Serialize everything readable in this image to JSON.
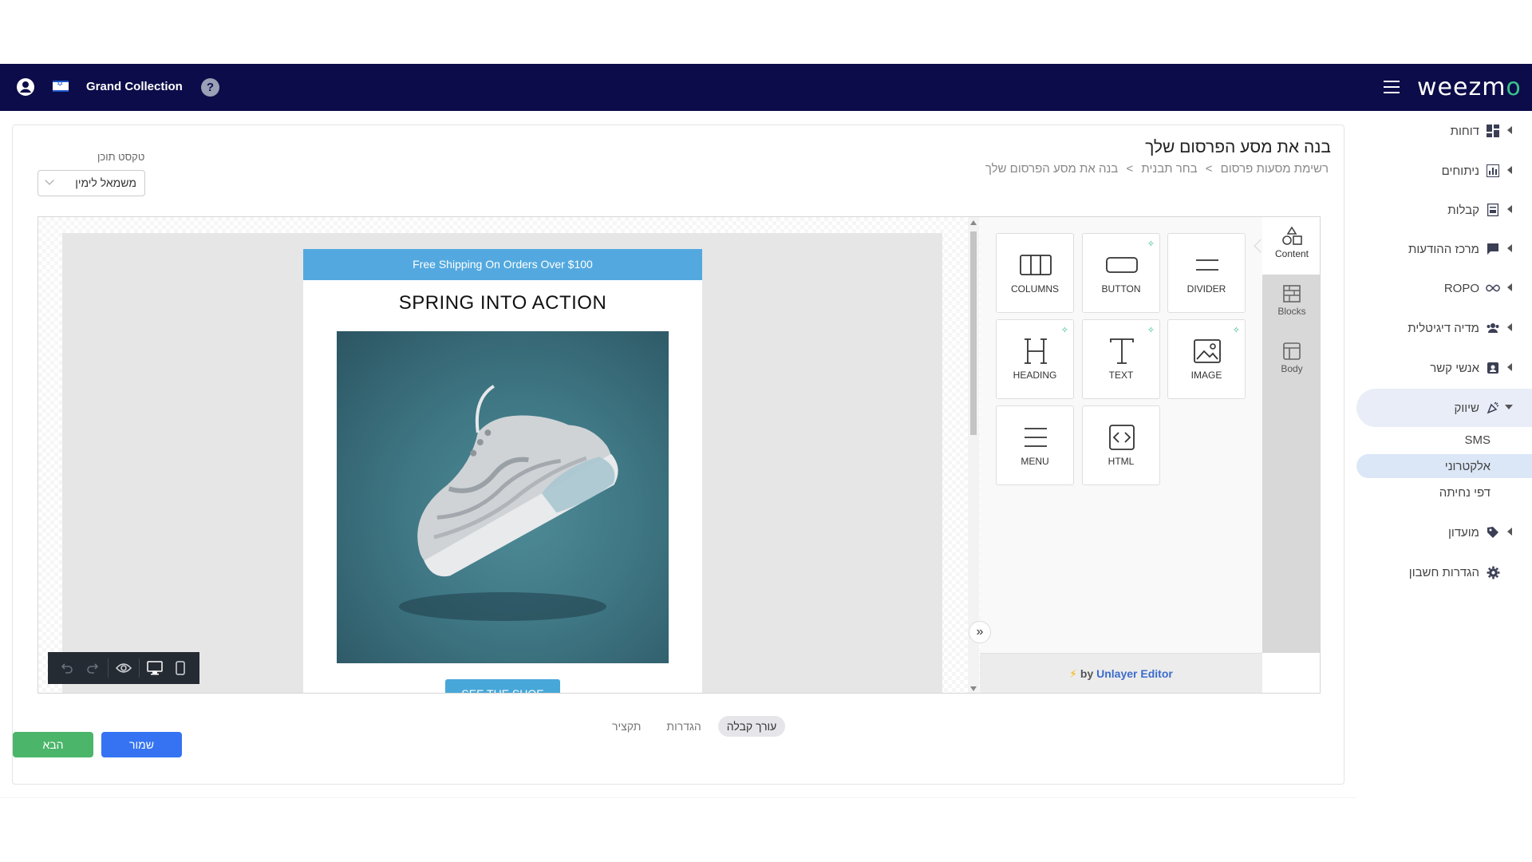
{
  "topbar": {
    "company": "Grand Collection",
    "help": "?",
    "logo_prefix": "weezm",
    "logo_suffix": "o",
    "icons": [
      "user-icon",
      "israel-flag-icon",
      "help-icon",
      "hamburger-icon"
    ]
  },
  "sidebar": {
    "items": [
      {
        "label": "דוחות",
        "icon": "dashboard-icon"
      },
      {
        "label": "ניתוחים",
        "icon": "analytics-icon"
      },
      {
        "label": "קבלות",
        "icon": "receipt-icon"
      },
      {
        "label": "מרכז ההודעות",
        "icon": "chat-icon"
      },
      {
        "label": "ROPO",
        "icon": "infinity-icon"
      },
      {
        "label": "מדיה דיגיטלית",
        "icon": "group-icon"
      },
      {
        "label": "אנשי קשר",
        "icon": "contacts-icon"
      },
      {
        "label": "שיווק",
        "icon": "megaphone-icon"
      },
      {
        "label": "מועדון",
        "icon": "tag-icon"
      },
      {
        "label": "הגדרות חשבון",
        "icon": "gear-icon"
      }
    ],
    "sub_items": [
      "SMS",
      "אלקטרוני",
      "דפי נחיתה"
    ]
  },
  "main": {
    "title": "בנה את מסע הפרסום שלך",
    "breadcrumb": [
      "רשימת מסעות פרסום",
      "בחר תבנית",
      "בנה את מסע הפרסום שלך"
    ],
    "breadcrumb_sep": ">",
    "direction_label": "טקסט תוכן",
    "direction_value": "משמאל לימין"
  },
  "email": {
    "shipping_banner": "Free Shipping On Orders Over $100",
    "heading": "SPRING INTO ACTION",
    "cta": "SEE THE SHOE",
    "colors": {
      "banner": "#53a9df",
      "cta": "#47a7d9",
      "hero_bg": "#3f7784"
    }
  },
  "tools": {
    "items": [
      {
        "label": "COLUMNS",
        "icon": "columns-icon",
        "ai": false
      },
      {
        "label": "BUTTON",
        "icon": "button-icon",
        "ai": true
      },
      {
        "label": "DIVIDER",
        "icon": "divider-icon",
        "ai": false
      },
      {
        "label": "HEADING",
        "icon": "heading-icon",
        "ai": true
      },
      {
        "label": "TEXT",
        "icon": "text-icon",
        "ai": true
      },
      {
        "label": "IMAGE",
        "icon": "image-icon",
        "ai": true
      },
      {
        "label": "MENU",
        "icon": "menu-icon",
        "ai": false
      },
      {
        "label": "HTML",
        "icon": "html-icon",
        "ai": false
      }
    ],
    "rail": [
      "Content",
      "Blocks",
      "Body"
    ],
    "footer_by": "by",
    "footer_brand": "Unlayer Editor"
  },
  "bottom_tabs": [
    "עורך קבלה",
    "הגדרות",
    "תקציר"
  ],
  "actions": {
    "next": "הבא",
    "save": "שמור"
  }
}
